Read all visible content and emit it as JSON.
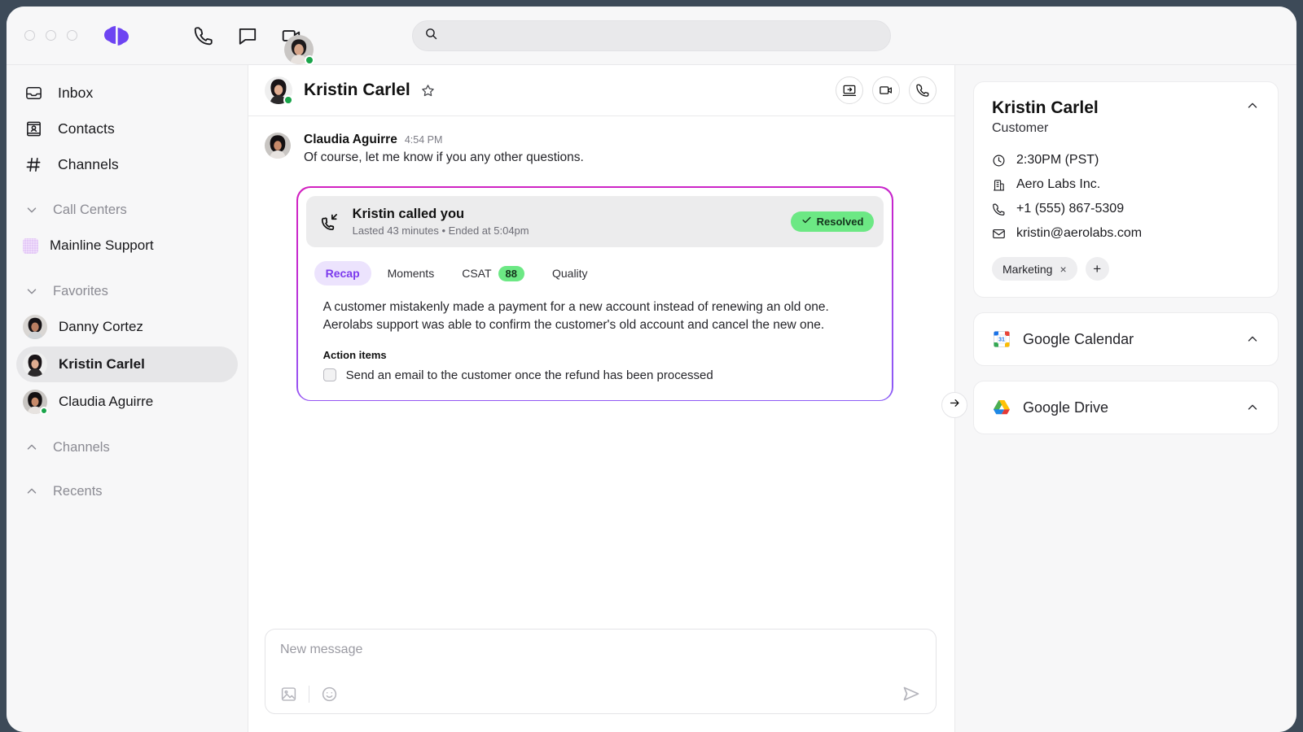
{
  "topbar": {
    "logo_name": "dialpad-logo",
    "icons": [
      {
        "name": "phone-icon",
        "label": "Phone"
      },
      {
        "name": "chat-icon",
        "label": "Messages"
      },
      {
        "name": "video-icon",
        "label": "Video"
      }
    ],
    "search": {
      "value": "",
      "placeholder": ""
    },
    "avatar_name": "user-avatar",
    "avatar_status": "online"
  },
  "sidebar": {
    "nav": [
      {
        "label": "Inbox",
        "icon": "inbox-icon"
      },
      {
        "label": "Contacts",
        "icon": "contacts-icon"
      },
      {
        "label": "Channels",
        "icon": "hash-icon"
      }
    ],
    "sections": [
      {
        "label": "Call Centers",
        "expanded": true,
        "chevron": "chevron-down-icon",
        "items": [
          {
            "label": "Mainline Support",
            "type": "swatch",
            "active": false,
            "status": "none"
          }
        ]
      },
      {
        "label": "Favorites",
        "expanded": true,
        "chevron": "chevron-down-icon",
        "items": [
          {
            "label": "Danny Cortez",
            "type": "avatar",
            "active": false,
            "status": "none"
          },
          {
            "label": "Kristin Carlel",
            "type": "avatar",
            "active": true,
            "status": "none"
          },
          {
            "label": "Claudia Aguirre",
            "type": "avatar",
            "active": false,
            "status": "online"
          }
        ]
      },
      {
        "label": "Channels",
        "expanded": false,
        "chevron": "chevron-up-icon",
        "items": []
      },
      {
        "label": "Recents",
        "expanded": false,
        "chevron": "chevron-up-icon",
        "items": []
      }
    ]
  },
  "chat": {
    "header": {
      "title": "Kristin Carlel",
      "avatar_status": "online",
      "star_icon": "star-outline-icon",
      "actions": [
        {
          "name": "screen-share-button",
          "icon": "screen-share-icon"
        },
        {
          "name": "video-call-button",
          "icon": "video-icon"
        },
        {
          "name": "phone-call-button",
          "icon": "phone-icon"
        }
      ]
    },
    "message": {
      "author": "Claudia Aguirre",
      "time": "4:54 PM",
      "text": "Of course, let me know if you any other questions."
    },
    "recap": {
      "call_icon": "incoming-call-icon",
      "title": "Kristin called you",
      "subtitle": "Lasted 43 minutes • Ended at 5:04pm",
      "status_badge": "Resolved",
      "status_color": "#6ce884",
      "tabs": [
        {
          "label": "Recap",
          "active": true,
          "badge": null
        },
        {
          "label": "Moments",
          "active": false,
          "badge": null
        },
        {
          "label": "CSAT",
          "active": false,
          "badge": "88"
        },
        {
          "label": "Quality",
          "active": false,
          "badge": null
        }
      ],
      "summary_line1": "A customer mistakenly made a payment for a new account instead of renewing an old one.",
      "summary_line2": "Aerolabs support was able to confirm the customer's old account and cancel the new one.",
      "action_items_label": "Action items",
      "action_items": [
        {
          "text": "Send an email to the customer once the refund has been processed",
          "checked": false
        }
      ],
      "accent_gradient_start": "#d322c0",
      "accent_gradient_end": "#8b5cf6"
    },
    "composer": {
      "placeholder": "New message",
      "value": "",
      "tools": [
        {
          "name": "image-attach-icon"
        },
        {
          "name": "emoji-icon"
        }
      ],
      "send_icon": "send-icon"
    },
    "collapse_panel_icon": "arrow-right-icon"
  },
  "right_panel": {
    "contact": {
      "name": "Kristin Carlel",
      "role": "Customer",
      "collapse_icon": "chevron-up-icon",
      "details": [
        {
          "icon": "clock-icon",
          "value": "2:30PM (PST)"
        },
        {
          "icon": "building-icon",
          "value": "Aero Labs Inc."
        },
        {
          "icon": "phone-icon",
          "value": "+1 (555) 867-5309"
        },
        {
          "icon": "mail-icon",
          "value": "kristin@aerolabs.com"
        }
      ],
      "tags": [
        {
          "label": "Marketing",
          "remove": "×"
        }
      ],
      "add_tag_label": "+"
    },
    "integrations": [
      {
        "name": "Google Calendar",
        "icon": "google-calendar-icon",
        "chevron": "chevron-up-icon"
      },
      {
        "name": "Google Drive",
        "icon": "google-drive-icon",
        "chevron": "chevron-up-icon"
      }
    ]
  }
}
